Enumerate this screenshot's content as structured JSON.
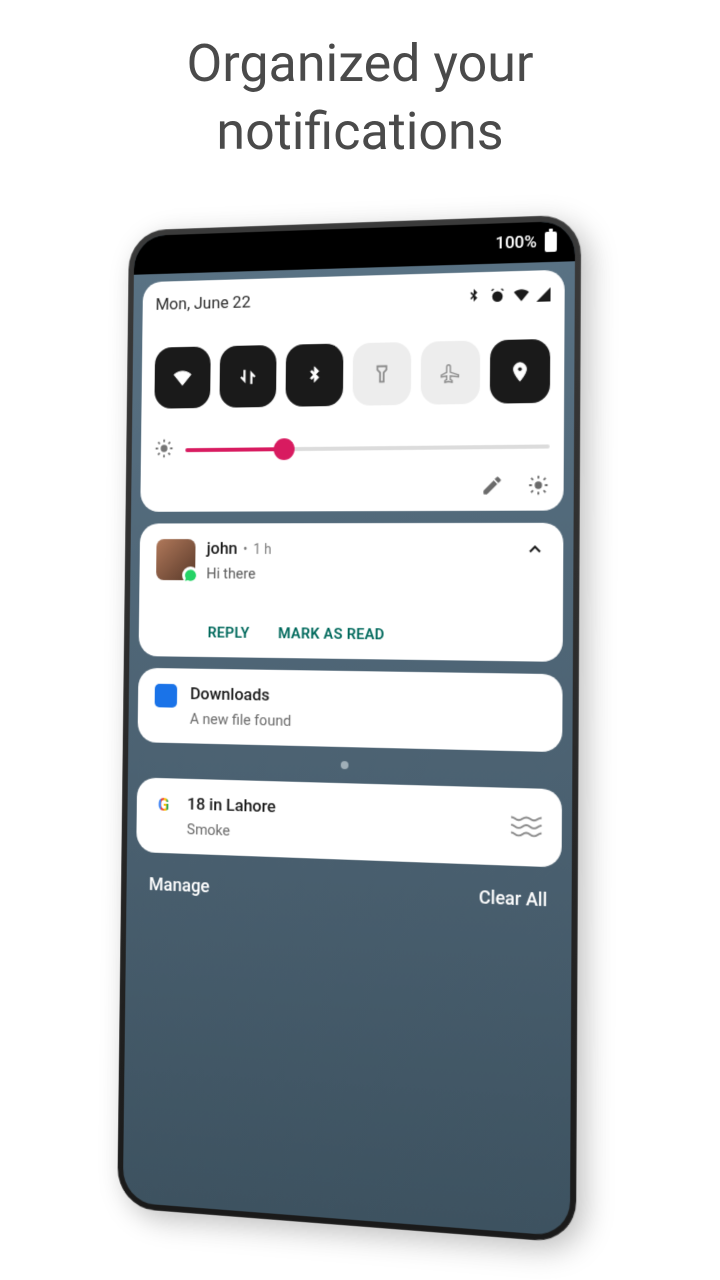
{
  "headline": "Organized your notifications",
  "statusbar": {
    "battery_pct": "100%"
  },
  "qs": {
    "date": "Mon, June 22",
    "toggles": [
      {
        "name": "wifi",
        "on": true
      },
      {
        "name": "data",
        "on": true
      },
      {
        "name": "bluetooth",
        "on": true
      },
      {
        "name": "flashlight",
        "on": false
      },
      {
        "name": "airplane",
        "on": false
      },
      {
        "name": "location",
        "on": true
      }
    ],
    "brightness_pct": 28
  },
  "message_notif": {
    "sender": "john",
    "time": "1 h",
    "body": "Hi there",
    "actions": {
      "reply": "REPLY",
      "mark_read": "MARK AS READ"
    }
  },
  "download_notif": {
    "title": "Downloads",
    "subtitle": "A new file found"
  },
  "weather_notif": {
    "title": "18 in Lahore",
    "subtitle": "Smoke"
  },
  "bottom": {
    "manage": "Manage",
    "clear_all": "Clear All"
  }
}
